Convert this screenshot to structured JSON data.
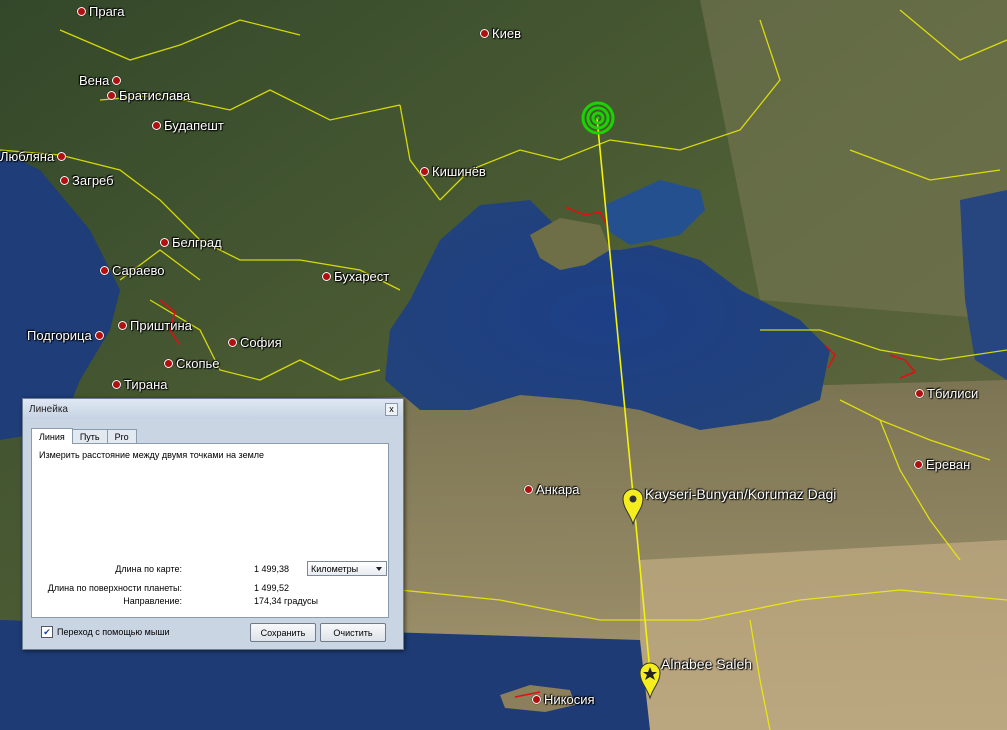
{
  "map": {
    "cities": [
      {
        "id": "praha",
        "label": "Прага"
      },
      {
        "id": "kiev",
        "label": "Киев"
      },
      {
        "id": "vena",
        "label": "Вена"
      },
      {
        "id": "bratislava",
        "label": "Братислава"
      },
      {
        "id": "budapest",
        "label": "Будапешт"
      },
      {
        "id": "ljubljana",
        "label": "Любляна"
      },
      {
        "id": "zagreb",
        "label": "Загреб"
      },
      {
        "id": "kishinev",
        "label": "Кишинёв"
      },
      {
        "id": "belgrad",
        "label": "Белград"
      },
      {
        "id": "saraevo",
        "label": "Сараево"
      },
      {
        "id": "buharest",
        "label": "Бухарест"
      },
      {
        "id": "podgorica",
        "label": "Подгорица"
      },
      {
        "id": "prishtina",
        "label": "Приштина"
      },
      {
        "id": "sofia",
        "label": "София"
      },
      {
        "id": "skopje",
        "label": "Скопье"
      },
      {
        "id": "tirana",
        "label": "Тирана"
      },
      {
        "id": "tbilisi",
        "label": "Тбилиси"
      },
      {
        "id": "erevan",
        "label": "Ереван"
      },
      {
        "id": "ankara",
        "label": "Анкара"
      },
      {
        "id": "nikosia",
        "label": "Никосия"
      }
    ],
    "placemarks": [
      {
        "id": "kayseri",
        "label": "Kayseri-Bunyan/Korumaz Dagi"
      },
      {
        "id": "alnabee",
        "label": "Alnabee Saleh"
      }
    ],
    "colors": {
      "measure_line": "#f2f20a",
      "border": "#f0f000",
      "target": "#19d400"
    }
  },
  "ruler": {
    "title": "Линейка",
    "close_label": "x",
    "tabs": [
      "Линия",
      "Путь",
      "Pro"
    ],
    "active_tab": "Линия",
    "description": "Измерить расстояние между двумя точками на земле",
    "map_length_label": "Длина по карте:",
    "map_length_value": "1 499,38",
    "unit": "Километры",
    "surface_length_label": "Длина по поверхности планеты:",
    "surface_length_value": "1 499,52",
    "heading_label": "Направление:",
    "heading_value": "174,34 градусы",
    "mouse_nav_label": "Переход с помощью мыши",
    "mouse_nav_checked": true,
    "save_label": "Сохранить",
    "clear_label": "Очистить"
  }
}
